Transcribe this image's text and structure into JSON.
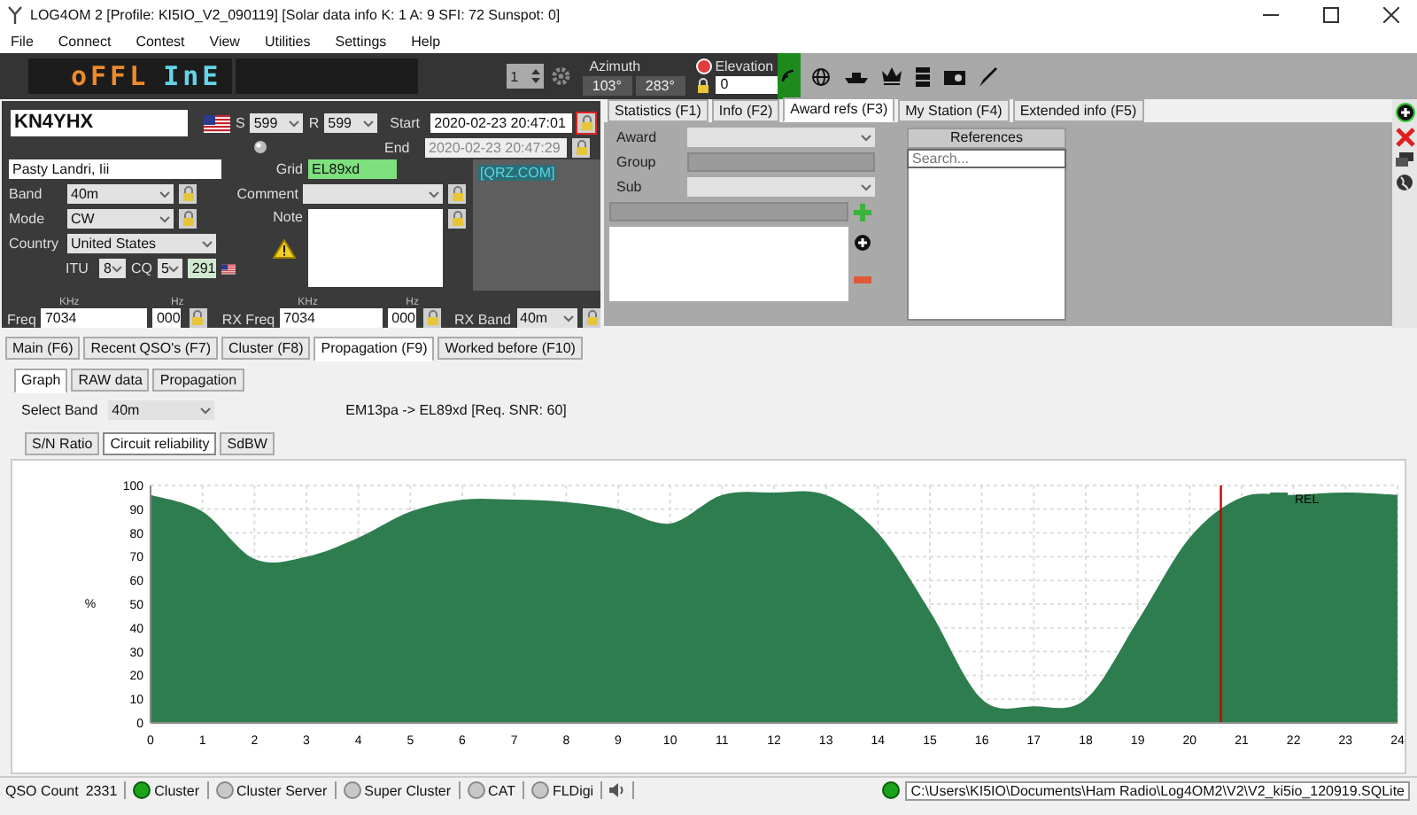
{
  "window": {
    "title": "LOG4OM 2 [Profile: KI5IO_V2_090119] [Solar data info K: 1 A: 9 SFI: 72 Sunspot: 0]"
  },
  "menu": [
    "File",
    "Connect",
    "Contest",
    "View",
    "Utilities",
    "Settings",
    "Help"
  ],
  "toolbar": {
    "display": [
      {
        "text": "oFFL",
        "color": "#f0892a"
      },
      {
        "text": "InE",
        "color": "#63d5e6"
      }
    ],
    "spinner": "1",
    "azimuth": {
      "label": "Azimuth",
      "values": [
        "103°",
        "283°"
      ]
    },
    "elevation": {
      "label": "Elevation",
      "value": "0"
    }
  },
  "qso": {
    "callsign": "KN4YHX",
    "s_label": "S",
    "s": "599",
    "r_label": "R",
    "r": "599",
    "start_label": "Start",
    "start": "2020-02-23 20:47:01",
    "end_label": "End",
    "end": "2020-02-23 20:47:29",
    "name": "Pasty Landri, Iii",
    "grid_label": "Grid",
    "grid": "EL89xd",
    "qrz": "[QRZ.COM]",
    "band_label": "Band",
    "band": "40m",
    "mode_label": "Mode",
    "mode": "CW",
    "comment_label": "Comment",
    "note_label": "Note",
    "country_label": "Country",
    "country": "United States",
    "itu_label": "ITU",
    "itu": "8",
    "cq_label": "CQ",
    "cq": "5",
    "dxcc": "291",
    "freq": {
      "label": "Freq",
      "khz_label": "KHz",
      "hz_label": "Hz",
      "khz": "7034",
      "hz": "000"
    },
    "rx_freq": {
      "label": "RX Freq",
      "khz_label": "KHz",
      "hz_label": "Hz",
      "khz": "7034",
      "hz": "000"
    },
    "rx_band_label": "RX Band",
    "rx_band": "40m"
  },
  "info_tabs": [
    {
      "label": "Statistics (F1)",
      "selected": false
    },
    {
      "label": "Info (F2)",
      "selected": false
    },
    {
      "label": "Award refs (F3)",
      "selected": true
    },
    {
      "label": "My Station (F4)",
      "selected": false
    },
    {
      "label": "Extended info (F5)",
      "selected": false
    }
  ],
  "award": {
    "award_label": "Award",
    "group_label": "Group",
    "sub_label": "Sub",
    "references_header": "References",
    "search_placeholder": "Search..."
  },
  "bottom_tabs": [
    {
      "label": "Main (F6)",
      "selected": false
    },
    {
      "label": "Recent QSO's (F7)",
      "selected": false
    },
    {
      "label": "Cluster (F8)",
      "selected": false
    },
    {
      "label": "Propagation (F9)",
      "selected": true
    },
    {
      "label": "Worked before (F10)",
      "selected": false
    }
  ],
  "propagation": {
    "sub_tabs": [
      {
        "label": "Graph",
        "selected": true
      },
      {
        "label": "RAW data",
        "selected": false
      },
      {
        "label": "Propagation",
        "selected": false
      }
    ],
    "band_label": "Select Band",
    "band": "40m",
    "path": "EM13pa -> EL89xd [Req. SNR: 60]",
    "modes": [
      {
        "label": "S/N Ratio",
        "selected": false
      },
      {
        "label": "Circuit reliability",
        "selected": true
      },
      {
        "label": "SdBW",
        "selected": false
      }
    ],
    "chart_data": {
      "type": "area",
      "ylabel": "%",
      "x": [
        0,
        1,
        2,
        3,
        4,
        5,
        6,
        7,
        8,
        9,
        10,
        11,
        12,
        13,
        14,
        15,
        16,
        17,
        18,
        19,
        20,
        21,
        22,
        23,
        24
      ],
      "series": [
        {
          "name": "REL",
          "color": "#2e7d4f",
          "values": [
            96,
            89,
            69,
            70,
            78,
            89,
            94,
            94,
            93,
            90,
            84,
            96,
            97,
            96,
            80,
            47,
            10,
            7,
            10,
            43,
            78,
            95,
            96,
            97,
            96
          ]
        }
      ],
      "xlim": [
        0,
        24
      ],
      "ylim": [
        0,
        100
      ],
      "xticks": [
        0,
        1,
        2,
        3,
        4,
        5,
        6,
        7,
        8,
        9,
        10,
        11,
        12,
        13,
        14,
        15,
        16,
        17,
        18,
        19,
        20,
        21,
        22,
        23,
        24
      ],
      "yticks": [
        0,
        10,
        20,
        30,
        40,
        50,
        60,
        70,
        80,
        90,
        100
      ],
      "grid": true,
      "ref_lines": [
        {
          "axis": "x",
          "value": 20.6,
          "color": "#cc0000"
        }
      ]
    }
  },
  "status_bar": {
    "qso_count_label": "QSO Count",
    "qso_count": "2331",
    "indicators": [
      {
        "label": "Cluster",
        "on": true
      },
      {
        "label": "Cluster Server",
        "on": false
      },
      {
        "label": "Super Cluster",
        "on": false
      },
      {
        "label": "CAT",
        "on": false
      },
      {
        "label": "FLDigi",
        "on": false
      }
    ],
    "database": {
      "path": "C:\\Users\\KI5IO\\Documents\\Ham Radio\\Log4OM2\\V2\\V2_ki5io_120919.SQLite",
      "on": true
    }
  }
}
